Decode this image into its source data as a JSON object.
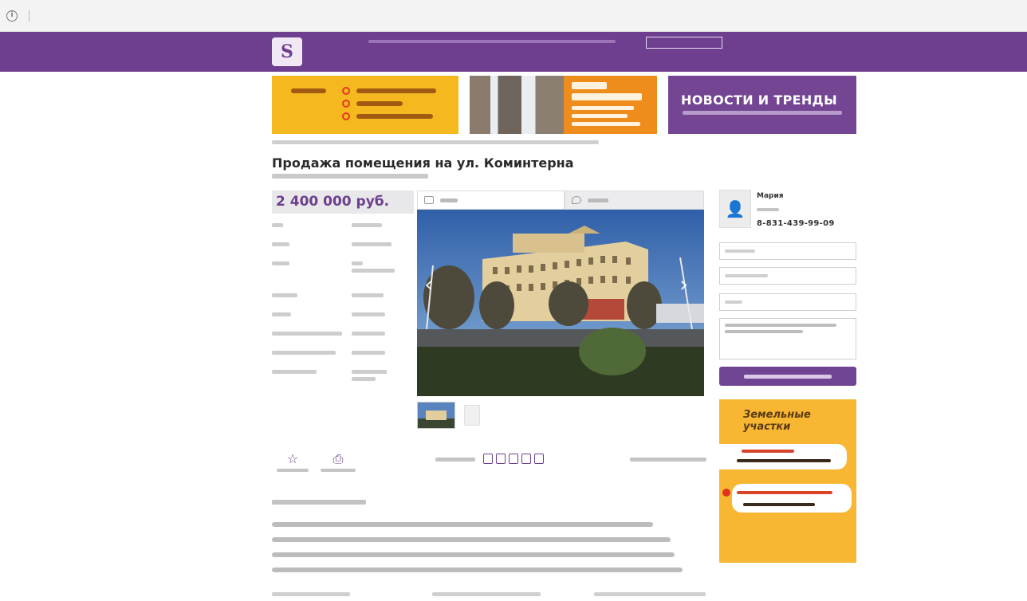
{
  "browser": {
    "info_icon": "info-icon",
    "security_label": "",
    "url_domain": "",
    "url_path": ""
  },
  "header": {
    "logo_glyph": "S",
    "site_name": "",
    "add_button": "",
    "top_links": [
      "",
      ""
    ],
    "menu": [
      "",
      "",
      "",
      "",
      "",
      "",
      "",
      "",
      ""
    ],
    "active_index": 0,
    "brand_color": "#6d3f8e"
  },
  "banners": {
    "news_title": "НОВОСТИ И ТРЕНДЫ",
    "news_subtitle": ""
  },
  "listing": {
    "title": "Продажа помещения на ул. Коминтерна",
    "price": "2 400 000 руб."
  },
  "agent": {
    "name": "Мария",
    "phone": "8-831-439-99-09"
  },
  "ad": {
    "headline_1": "Земельные",
    "headline_2": "участки"
  },
  "icons": {
    "favorite": "star-icon",
    "print": "printer-icon"
  }
}
